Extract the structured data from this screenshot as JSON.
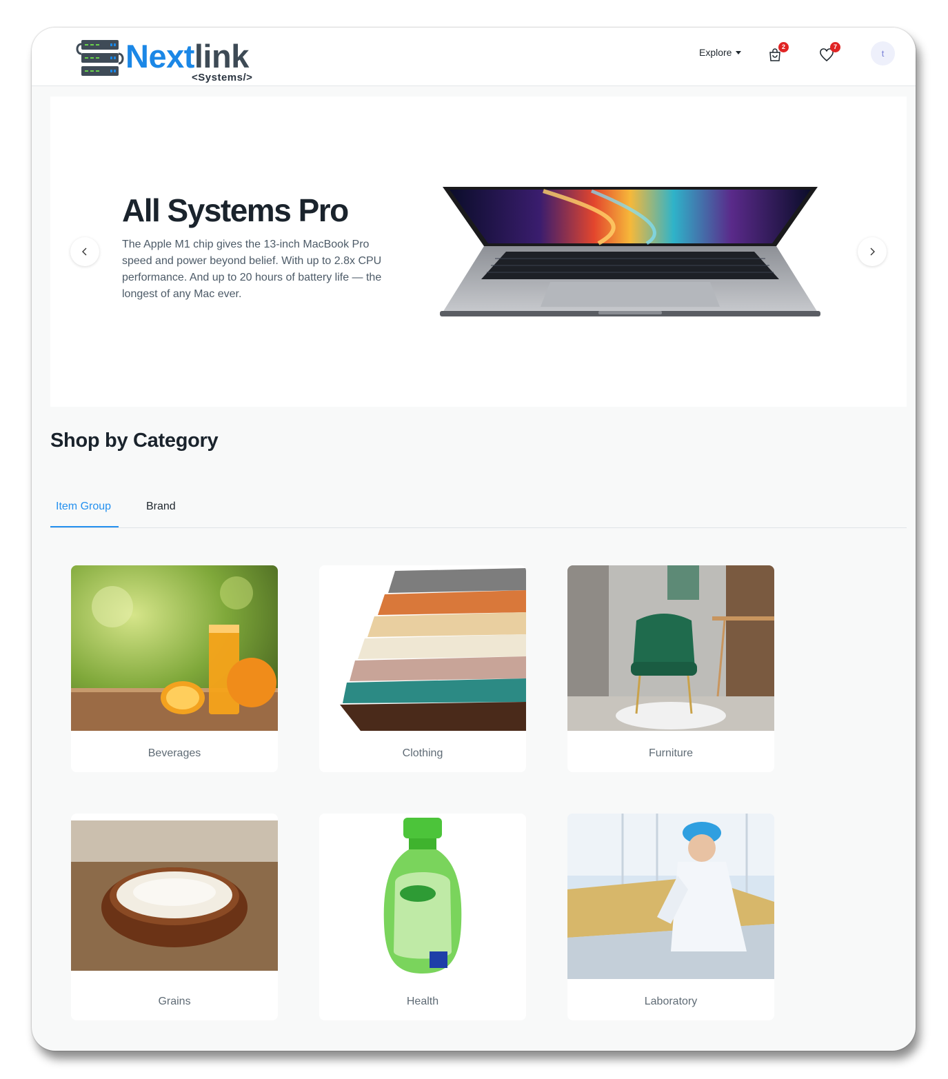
{
  "brand": {
    "name_part1": "Next",
    "name_part2": "link",
    "tagline": "<Systems/>"
  },
  "navbar": {
    "explore_label": "Explore",
    "cart": {
      "icon": "cart-icon",
      "count": "2"
    },
    "wishlist": {
      "icon": "heart-icon",
      "count": "7"
    },
    "avatar_initial": "t"
  },
  "hero": {
    "title": "All Systems Pro",
    "description": "The Apple M1 chip gives the 13-inch MacBook Pro speed and power beyond belief. With up to 2.8x CPU performance. And up to 20 hours of battery life — the longest of any Mac ever."
  },
  "categories": {
    "title": "Shop by Category",
    "tabs": [
      {
        "label": "Item Group",
        "active": true
      },
      {
        "label": "Brand",
        "active": false
      }
    ],
    "items": [
      {
        "label": "Beverages"
      },
      {
        "label": "Clothing"
      },
      {
        "label": "Furniture"
      },
      {
        "label": "Grains"
      },
      {
        "label": "Health"
      },
      {
        "label": "Laboratory"
      }
    ]
  },
  "colors": {
    "accent": "#2490ef",
    "brand_blue": "#1b87e6",
    "badge": "#e02424"
  }
}
